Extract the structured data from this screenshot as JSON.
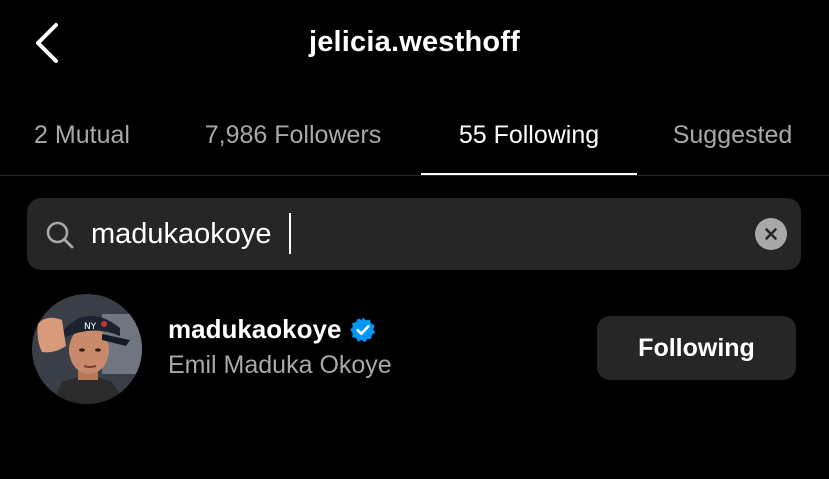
{
  "header": {
    "title": "jelicia.westhoff",
    "back_icon": "chevron-left-icon"
  },
  "tabs": [
    {
      "label": "2 Mutual",
      "active": false
    },
    {
      "label": "7,986 Followers",
      "active": false
    },
    {
      "label": "55 Following",
      "active": true
    },
    {
      "label": "Suggested",
      "active": false
    }
  ],
  "search": {
    "value": "madukaokoye",
    "placeholder": "",
    "search_icon": "search-icon",
    "clear_icon": "clear-icon"
  },
  "results": [
    {
      "username": "madukaokoye",
      "full_name": "Emil Maduka Okoye",
      "verified": true,
      "button_label": "Following"
    }
  ],
  "colors": {
    "background": "#000000",
    "surface": "#262626",
    "text_primary": "#ffffff",
    "text_secondary": "#a8a8a8",
    "verified_badge": "#0095f6"
  }
}
